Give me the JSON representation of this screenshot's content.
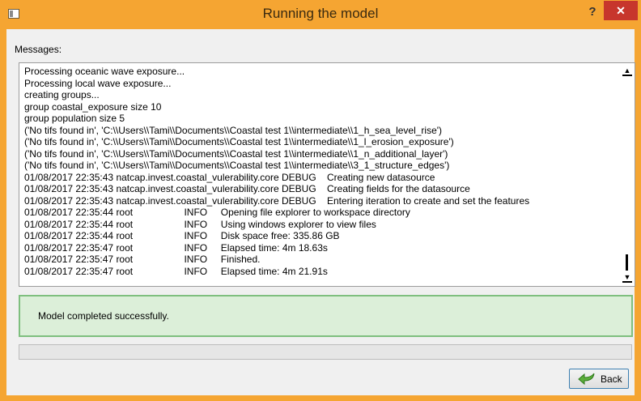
{
  "window": {
    "title": "Running the model",
    "help_label": "?",
    "close_label": "✕"
  },
  "messages_label": "Messages:",
  "log_lines": [
    "Processing oceanic wave exposure...",
    "Processing local wave exposure...",
    "creating groups...",
    "group coastal_exposure size 10",
    "group population size 5",
    "('No tifs found in', 'C:\\\\Users\\\\Tami\\\\Documents\\\\Coastal test 1\\\\intermediate\\\\1_h_sea_level_rise')",
    "('No tifs found in', 'C:\\\\Users\\\\Tami\\\\Documents\\\\Coastal test 1\\\\intermediate\\\\1_l_erosion_exposure')",
    "('No tifs found in', 'C:\\\\Users\\\\Tami\\\\Documents\\\\Coastal test 1\\\\intermediate\\\\1_n_additional_layer')",
    "('No tifs found in', 'C:\\\\Users\\\\Tami\\\\Documents\\\\Coastal test 1\\\\intermediate\\\\3_1_structure_edges')",
    "01/08/2017 22:35:43 natcap.invest.coastal_vulerability.core DEBUG    Creating new datasource",
    "01/08/2017 22:35:43 natcap.invest.coastal_vulerability.core DEBUG    Creating fields for the datasource",
    "01/08/2017 22:35:43 natcap.invest.coastal_vulerability.core DEBUG    Entering iteration to create and set the features",
    "01/08/2017 22:35:44 root                   INFO     Opening file explorer to workspace directory",
    "01/08/2017 22:35:44 root                   INFO     Using windows explorer to view files",
    "01/08/2017 22:35:44 root                   INFO     Disk space free: 335.86 GB",
    "01/08/2017 22:35:47 root                   INFO     Elapsed time: 4m 18.63s",
    "01/08/2017 22:35:47 root                   INFO     Finished.",
    "01/08/2017 22:35:47 root                   INFO     Elapsed time: 4m 21.91s"
  ],
  "status_message": "Model completed successfully.",
  "progress": 0,
  "back_button": {
    "label": "Back",
    "icon": "back-arrow-icon"
  },
  "colors": {
    "title_bar": "#f5a532",
    "close": "#c7362c",
    "status_bg": "#dcefd9",
    "status_border": "#7fbf7f"
  }
}
